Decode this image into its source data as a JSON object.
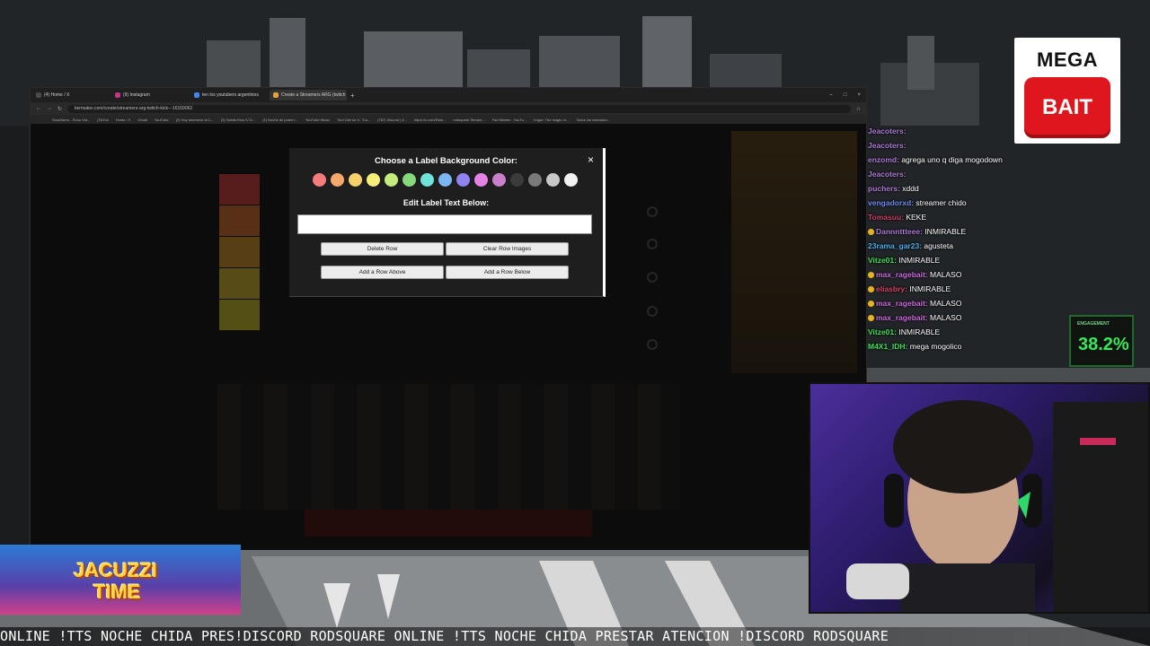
{
  "browser": {
    "tabs": [
      {
        "label": "(4) Home / X",
        "active": false
      },
      {
        "label": "(9) Instagram",
        "active": false
      },
      {
        "label": "ten los youtubers argentinos",
        "active": false
      },
      {
        "label": "Create a Streamers ARG (twitch",
        "active": true
      }
    ],
    "url": "tiermaker.com/create/streamers-arg-twitch-kick---16159062",
    "bookmarks": [
      "SoraSaero - Sono Vid...",
      "[TikTok",
      "Home / X",
      "Gmail",
      "YouTube",
      "(2) Hoy amenece al C...",
      "(3) Saints Row IV D...",
      "(1) Noche de joden t...",
      "YouTube Music",
      "Toni Giiri on X: \"Ca...",
      "(787) Discord | #...",
      "https://c.com/Rain...",
      "rodsquare Stream...",
      "Fart Master - YouTu...",
      "Imgur: The magic of...",
      "Todos los marcador..."
    ]
  },
  "modal": {
    "title": "Choose a Label Background Color:",
    "edit_title": "Edit Label Text Below:",
    "label_text": "",
    "close": "×",
    "colors": [
      "#f47c7c",
      "#f7a86b",
      "#f6d06b",
      "#f6ef7a",
      "#c4ec7a",
      "#84d97a",
      "#6fe3d8",
      "#7cb7f4",
      "#8f82f2",
      "#e681e6",
      "#c97fc9",
      "#3b3b3b",
      "#7a7a7a",
      "#c8c8c8",
      "#f2f2f2"
    ],
    "buttons": {
      "delete_row": "Delete Row",
      "clear_row_images": "Clear Row Images",
      "add_row_above": "Add a Row Above",
      "add_row_below": "Add a Row Below"
    }
  },
  "overlay": {
    "mega": "MEGA",
    "bait": "BAIT",
    "engagement_label": "ENGAGEMENT",
    "engagement_value": "38.2%",
    "jacuzzi_1": "JACUZZI",
    "jacuzzi_2": "TIME",
    "ticker": "ONLINE !TTS NOCHE CHIDA PRES!DISCORD RODSQUARE ONLINE !TTS NOCHE CHIDA PRESTAR ATENCION !DISCORD RODSQUARE"
  },
  "chat": [
    {
      "user": "Jeacoters:",
      "msg": "",
      "color": "#b07ad8",
      "badge": false
    },
    {
      "user": "Jeacoters:",
      "msg": "",
      "color": "#b07ad8",
      "badge": false
    },
    {
      "user": "enzomd:",
      "msg": "agrega uno q diga mogodown",
      "color": "#b07ad8",
      "badge": false
    },
    {
      "user": "Jeacoters:",
      "msg": "",
      "color": "#b07ad8",
      "badge": false
    },
    {
      "user": "puchers:",
      "msg": "xddd",
      "color": "#b07ad8",
      "badge": false
    },
    {
      "user": "vengadorxd:",
      "msg": "streamer chido",
      "color": "#6f8cf4",
      "badge": false
    },
    {
      "user": "Tomasuu:",
      "msg": "KEKE",
      "color": "#d0406a",
      "badge": false
    },
    {
      "user": "Dannnttteee:",
      "msg": "INMIRABLE",
      "color": "#b07ad8",
      "badge": true
    },
    {
      "user": "23rama_gar23:",
      "msg": "agusteta",
      "color": "#4ab0f0",
      "badge": false
    },
    {
      "user": "Vitze01:",
      "msg": "INMIRABLE",
      "color": "#3fe05a",
      "badge": false
    },
    {
      "user": "max_ragebait:",
      "msg": "MALASO",
      "color": "#d06ae0",
      "badge": true
    },
    {
      "user": "eliasbry:",
      "msg": "INMIRABLE",
      "color": "#e0406a",
      "badge": true
    },
    {
      "user": "max_ragebait:",
      "msg": "MALASO",
      "color": "#d06ae0",
      "badge": true
    },
    {
      "user": "max_ragebait:",
      "msg": "MALASO",
      "color": "#d06ae0",
      "badge": true
    },
    {
      "user": "Vitze01:",
      "msg": "INMIRABLE",
      "color": "#3fe05a",
      "badge": false
    },
    {
      "user": "M4X1_IDH:",
      "msg": "mega mogolico",
      "color": "#3fe05a",
      "badge": false
    }
  ]
}
